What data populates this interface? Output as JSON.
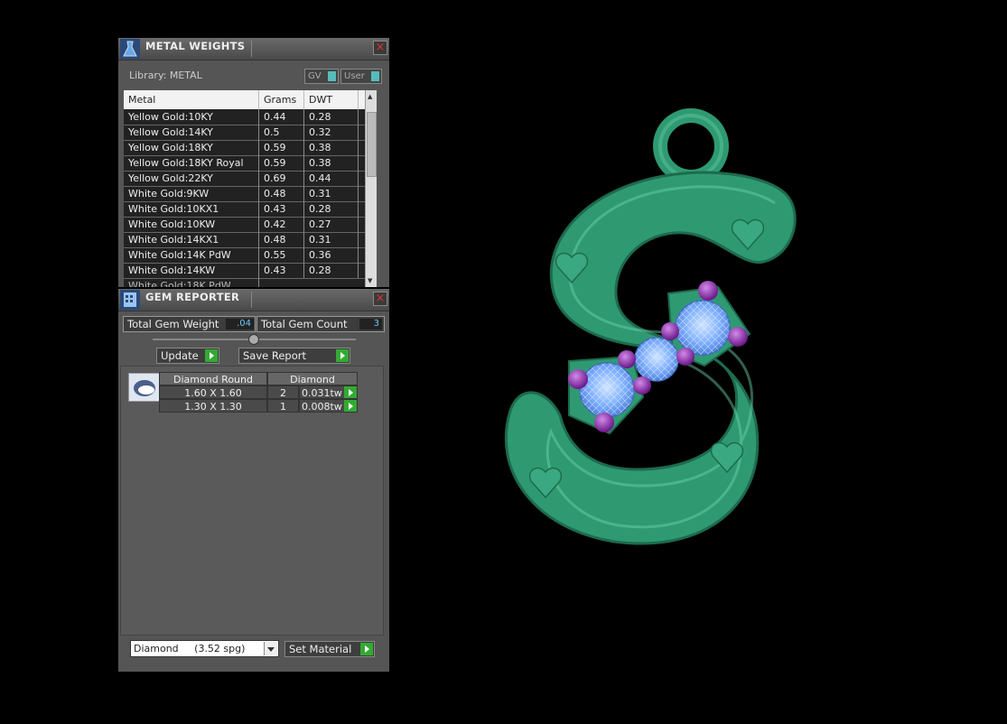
{
  "metal_panel": {
    "title": "METAL WEIGHTS",
    "library": "Library: METAL",
    "toggle_gv": "GV",
    "toggle_user": "User",
    "columns": [
      "Metal",
      "Grams",
      "DWT"
    ],
    "rows": [
      [
        "Yellow Gold:10KY",
        "0.44",
        "0.28"
      ],
      [
        "Yellow Gold:14KY",
        "0.5",
        "0.32"
      ],
      [
        "Yellow Gold:18KY",
        "0.59",
        "0.38"
      ],
      [
        "Yellow Gold:18KY Royal",
        "0.59",
        "0.38"
      ],
      [
        "Yellow Gold:22KY",
        "0.69",
        "0.44"
      ],
      [
        "White Gold:9KW",
        "0.48",
        "0.31"
      ],
      [
        "White Gold:10KX1",
        "0.43",
        "0.28"
      ],
      [
        "White Gold:10KW",
        "0.42",
        "0.27"
      ],
      [
        "White Gold:14KX1",
        "0.48",
        "0.31"
      ],
      [
        "White Gold:14K PdW",
        "0.55",
        "0.36"
      ],
      [
        "White Gold:14KW",
        "0.43",
        "0.28"
      ]
    ]
  },
  "gem_panel": {
    "title": "GEM REPORTER",
    "total_weight_label": "Total Gem Weight",
    "total_weight_value": ".04",
    "total_count_label": "Total Gem Count",
    "total_count_value": "3",
    "update_label": "Update",
    "save_report_label": "Save Report",
    "header_shape": "Diamond Round",
    "header_material": "Diamond",
    "gem_rows": [
      {
        "size": "1.60 X 1.60",
        "count": "2",
        "weight": "0.031tw"
      },
      {
        "size": "1.30 X 1.30",
        "count": "1",
        "weight": "0.008tw"
      }
    ],
    "material_select": "Diamond     (3.52 spg)",
    "set_material_label": "Set Material"
  },
  "colors": {
    "pendant": "#2f9a72",
    "gem_blue": "#7fb0ff",
    "prong_purple": "#8a2aa0"
  }
}
